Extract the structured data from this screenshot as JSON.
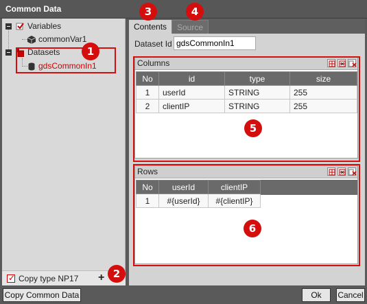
{
  "window": {
    "title": "Common Data"
  },
  "tree": {
    "variables_label": "Variables",
    "variable_item": "commonVar1",
    "datasets_label": "Datasets",
    "dataset_item": "gdsCommonIn1"
  },
  "left_footer": {
    "copy_type_label": "Copy type NP17",
    "add_symbol": "+"
  },
  "tabs": [
    {
      "label": "Contents",
      "active": true
    },
    {
      "label": "Source",
      "active": false
    }
  ],
  "dataset_id": {
    "label": "Dataset Id",
    "value": "gdsCommonIn1"
  },
  "columns_panel": {
    "title": "Columns",
    "headers": [
      "No",
      "id",
      "type",
      "size"
    ],
    "rows": [
      [
        "1",
        "userId",
        "STRING",
        "255"
      ],
      [
        "2",
        "clientIP",
        "STRING",
        "255"
      ]
    ]
  },
  "rows_panel": {
    "title": "Rows",
    "headers": [
      "No",
      "userId",
      "clientIP"
    ],
    "rows": [
      [
        "1",
        "#{userId}",
        "#{clientIP}"
      ]
    ]
  },
  "callouts": [
    "1",
    "2",
    "3",
    "4",
    "5",
    "6"
  ],
  "buttons": {
    "copy_common_data": "Copy Common Data",
    "ok": "Ok",
    "cancel": "Cancel"
  },
  "colors": {
    "highlight": "#d40d0d",
    "dataset_text": "#cc0000",
    "header_bg": "#6a6a6a"
  }
}
